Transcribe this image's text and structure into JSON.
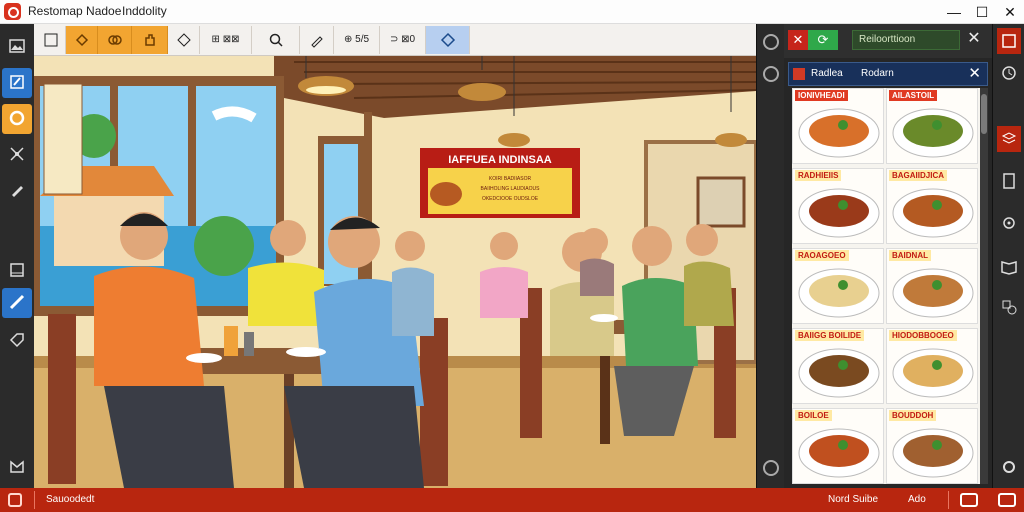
{
  "window": {
    "title_left": "Restomap Nadoe",
    "title_right": "Inddolity",
    "minimize": "—",
    "maximize": "☐",
    "close": "✕"
  },
  "toolbar": {
    "tool_select_label": "⊞ ⊠⊠",
    "tool_lasso_label": "⊕ 5/5",
    "tool_shape_label": "⊃ ⊠0"
  },
  "panel": {
    "close_label": "✕",
    "confirm_label": "⟳",
    "field_value": "Reiloorttioon",
    "field_close": "✕",
    "sub_tab1": "Radlea",
    "sub_tab2": "Rodarn",
    "sub_close": "✕",
    "menu_items": [
      {
        "label": "IONIVHEADI",
        "style": "red"
      },
      {
        "label": "AILASTOIL",
        "style": "red"
      },
      {
        "label": "RADHIEIIS",
        "style": "yellow"
      },
      {
        "label": "BAGAIIDJICA",
        "style": "yellow"
      },
      {
        "label": "RAOAGOEO",
        "style": "yellow"
      },
      {
        "label": "BAIDNAL",
        "style": "yellow"
      },
      {
        "label": "BAIIGG BOILIDE",
        "style": "yellow"
      },
      {
        "label": "HIODOBBOOEO",
        "style": "yellow"
      },
      {
        "label": "BOILOE",
        "style": "yellow"
      },
      {
        "label": "BOUDDOH",
        "style": "yellow"
      }
    ]
  },
  "canvas": {
    "sign_title": "IAFFUEA INDINSAA",
    "sign_lines": [
      "KOIRI BADIIASOR",
      "BAIIHOLING LAUDIAOUS",
      "OKEDCIOOE OUDSLOE"
    ]
  },
  "statusbar": {
    "status_text": "Sauoodedt",
    "mode_text": "Nord Suibe",
    "zoom_text": "Ado"
  },
  "colors": {
    "accent_red": "#c6251b",
    "accent_orange": "#f2a531",
    "statusbar": "#b8260f",
    "panel_green": "#2fa84a"
  },
  "icons": {
    "app": "restaurant-logo-icon",
    "left_tools": [
      "image-icon",
      "brush-icon",
      "circle-icon",
      "transform-icon",
      "pen-icon",
      "frame-icon",
      "ruler-icon",
      "tag-icon",
      "expand-icon"
    ],
    "right_tools": [
      "save-icon",
      "history-icon",
      "layers-icon",
      "doc-icon",
      "settings-icon",
      "book-icon",
      "shapes-icon",
      "history-icon",
      "gear-icon"
    ]
  }
}
